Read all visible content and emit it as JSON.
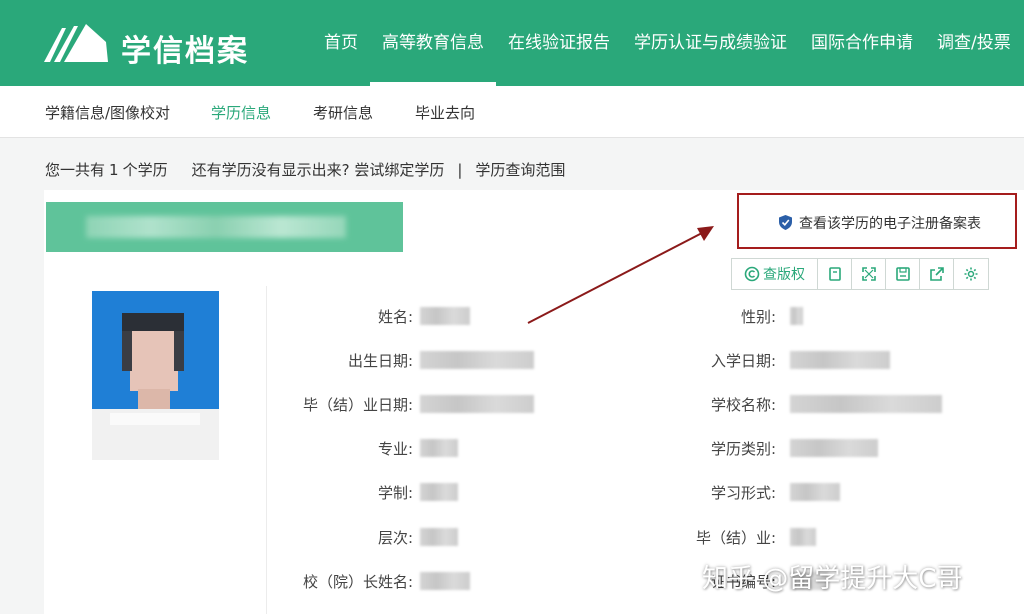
{
  "header": {
    "logo_text": "学信档案",
    "nav": [
      "首页",
      "高等教育信息",
      "在线验证报告",
      "学历认证与成绩验证",
      "国际合作申请",
      "调查/投票"
    ]
  },
  "subnav": [
    "学籍信息/图像校对",
    "学历信息",
    "考研信息",
    "毕业去向"
  ],
  "summary": {
    "prefix": "您一共有",
    "count": "1",
    "suffix": "个学历",
    "missing_text": "还有学历没有显示出来?",
    "bind_link": "尝试绑定学历",
    "separator": "|",
    "range_link": "学历查询范围"
  },
  "record": {
    "registration_link": "查看该学历的电子注册备案表",
    "toolbar": {
      "copyright_label": "查版权",
      "icons": [
        "copy-icon",
        "fullscreen-icon",
        "save-icon",
        "share-icon",
        "settings-icon"
      ]
    },
    "fields_left": [
      "姓名:",
      "出生日期:",
      "毕（结）业日期:",
      "专业:",
      "学制:",
      "层次:",
      "校（院）长姓名:"
    ],
    "fields_right": [
      "性别:",
      "入学日期:",
      "学校名称:",
      "学历类别:",
      "学习形式:",
      "毕（结）业:",
      "证书编号:"
    ]
  },
  "watermark": "知乎 @留学提升大C哥",
  "colors": {
    "brand": "#2aa87a",
    "highlight_border": "#a51d1d",
    "arrow": "#8b1a1a"
  }
}
